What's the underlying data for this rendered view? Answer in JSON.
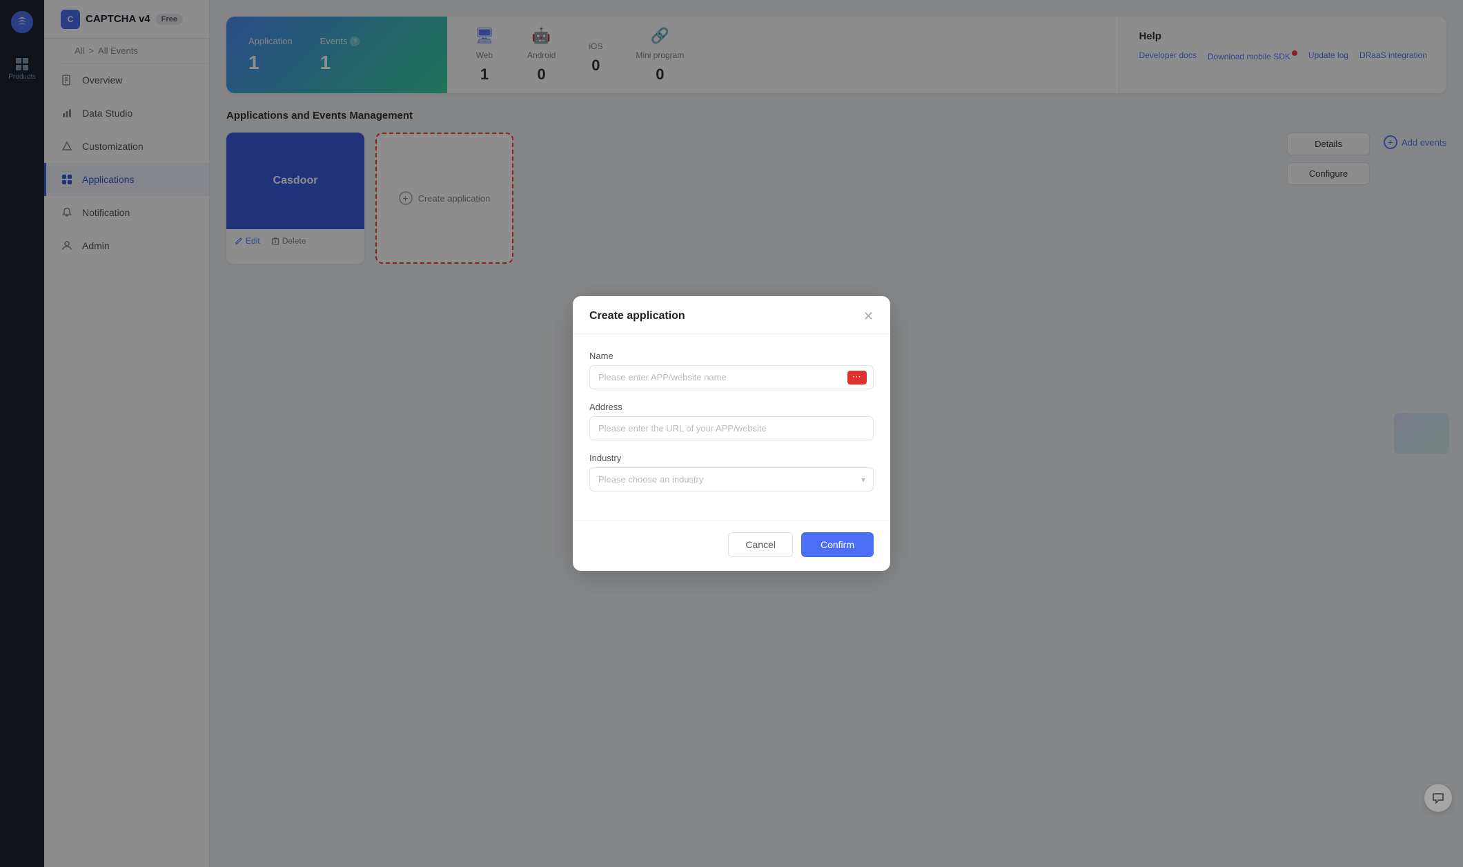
{
  "app": {
    "name": "CAPTCHA v4",
    "badge": "Free",
    "breadcrumb": {
      "all": "All",
      "separator": ">",
      "current": "All Events"
    }
  },
  "products_label": "Products",
  "sidebar": {
    "items": [
      {
        "id": "overview",
        "label": "Overview",
        "icon": "doc"
      },
      {
        "id": "data-studio",
        "label": "Data Studio",
        "icon": "chart"
      },
      {
        "id": "customization",
        "label": "Customization",
        "icon": "triangle"
      },
      {
        "id": "applications",
        "label": "Applications",
        "icon": "apps",
        "active": true
      },
      {
        "id": "notification",
        "label": "Notification",
        "icon": "bell"
      },
      {
        "id": "admin",
        "label": "Admin",
        "icon": "person"
      }
    ]
  },
  "stats": {
    "application_label": "Application",
    "events_label": "Events",
    "application_count": "1",
    "events_count": "1",
    "platforms": [
      {
        "id": "web",
        "label": "Web",
        "value": "1",
        "icon": "🖥"
      },
      {
        "id": "android",
        "label": "Android",
        "value": "0",
        "icon": "🤖"
      },
      {
        "id": "ios",
        "label": "iOS",
        "value": "0",
        "icon": ""
      },
      {
        "id": "mini-program",
        "label": "Mini program",
        "value": "0",
        "icon": "🔗"
      }
    ],
    "help": {
      "title": "Help",
      "links": [
        {
          "label": "Developer docs",
          "id": "dev-docs"
        },
        {
          "label": "Download mobile SDK",
          "id": "mobile-sdk",
          "badge": true
        },
        {
          "label": "Update log",
          "id": "update-log"
        },
        {
          "label": "DRaaS integration",
          "id": "draas"
        }
      ]
    }
  },
  "section_title": "Applications and Events Management",
  "app_card": {
    "name": "Casdoor",
    "thumb_color": "#3b5bdb"
  },
  "action_buttons": {
    "details": "Details",
    "configure": "Configure",
    "edit": "Edit",
    "delete": "Delete"
  },
  "create_app_label": "Create application",
  "add_events_label": "Add events",
  "modal": {
    "title": "Create application",
    "name_label": "Name",
    "name_placeholder": "Please enter APP/website name",
    "address_label": "Address",
    "address_placeholder": "Please enter the URL of your APP/website",
    "industry_label": "Industry",
    "industry_placeholder": "Please choose an industry",
    "cancel_label": "Cancel",
    "confirm_label": "Confirm"
  }
}
